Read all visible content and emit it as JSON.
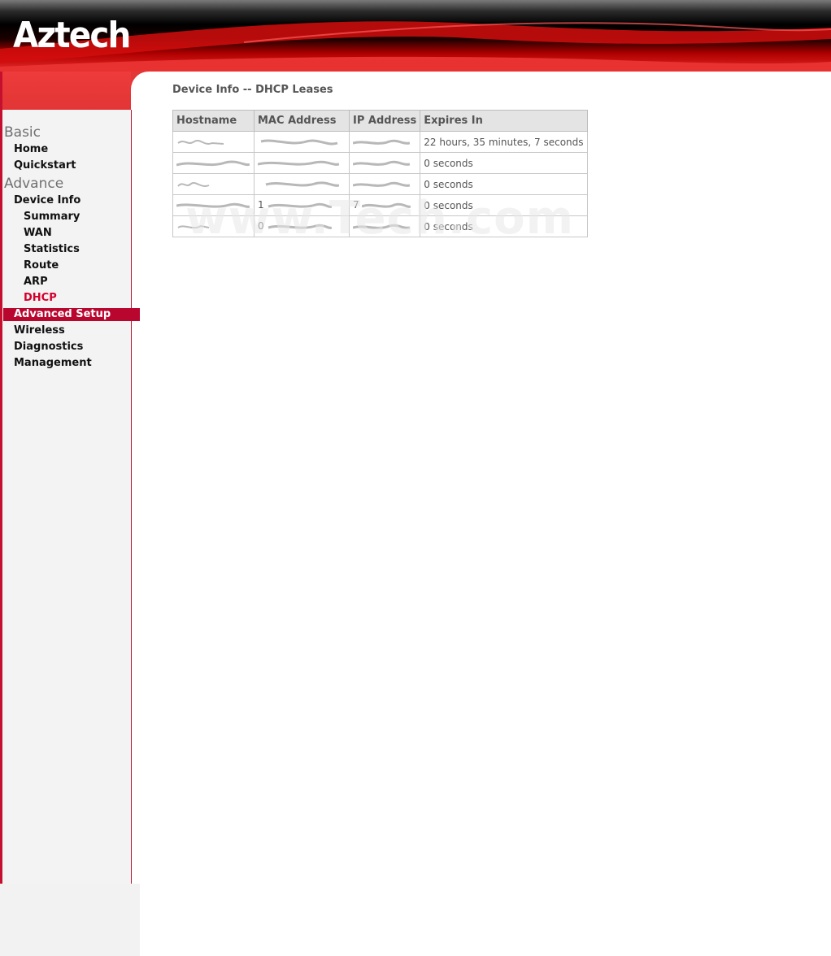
{
  "header": {
    "logo_text": "Aztech"
  },
  "sidebar": {
    "sections": [
      {
        "label": "Basic"
      },
      {
        "label": "Advance"
      }
    ],
    "items": {
      "home": "Home",
      "quickstart": "Quickstart",
      "device_info": "Device Info",
      "summary": "Summary",
      "wan": "WAN",
      "statistics": "Statistics",
      "route": "Route",
      "arp": "ARP",
      "dhcp": "DHCP",
      "advanced_setup": "Advanced Setup",
      "wireless": "Wireless",
      "diagnostics": "Diagnostics",
      "management": "Management"
    }
  },
  "main": {
    "title": "Device Info -- DHCP Leases",
    "table": {
      "columns": [
        "Hostname",
        "MAC Address",
        "IP Address",
        "Expires In"
      ],
      "rows": [
        {
          "hostname": "",
          "mac": "",
          "ip": "",
          "expires": "22 hours, 35 minutes, 7 seconds"
        },
        {
          "hostname": "",
          "mac": "",
          "ip": "",
          "expires": "0 seconds"
        },
        {
          "hostname": "",
          "mac": "",
          "ip": "",
          "expires": "0 seconds"
        },
        {
          "hostname": "",
          "mac": "1",
          "ip": "7",
          "expires": "0 seconds"
        },
        {
          "hostname": "",
          "mac": "0",
          "ip": "",
          "expires": "0 seconds"
        }
      ]
    },
    "watermark": "www.Tech.com"
  },
  "colors": {
    "brand_red": "#d3002c",
    "highlight": "#b8062f",
    "sidebar_bg": "#f3f3f3"
  }
}
